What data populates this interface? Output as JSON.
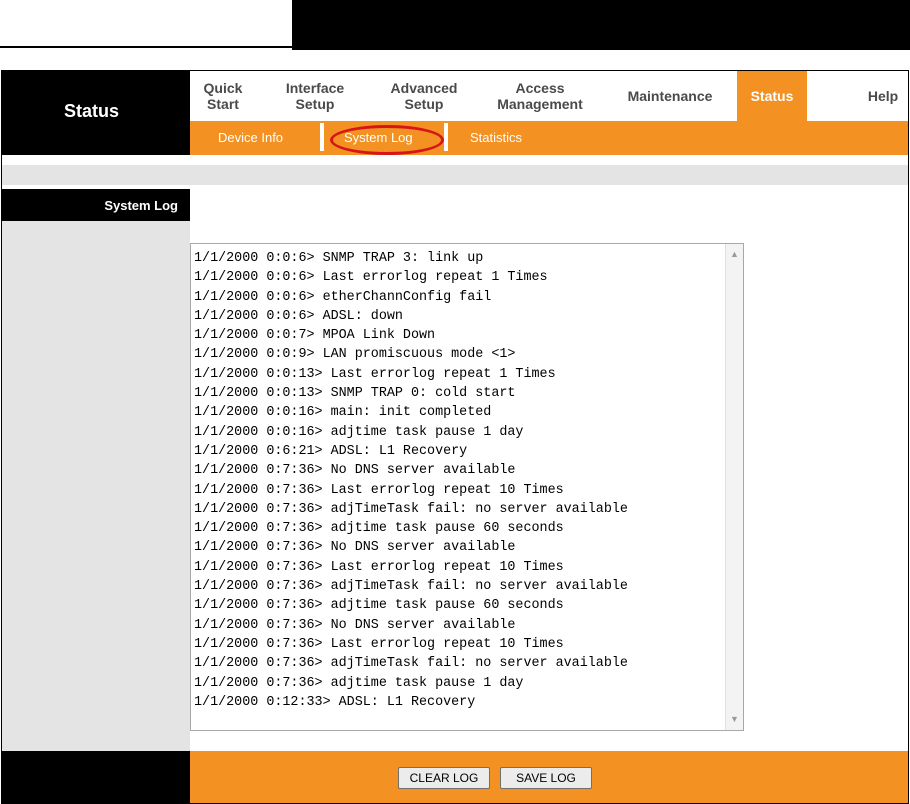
{
  "header": {
    "page_title": "Status"
  },
  "main_nav": [
    {
      "line1": "Quick",
      "line2": "Start"
    },
    {
      "line1": "Interface",
      "line2": "Setup"
    },
    {
      "line1": "Advanced",
      "line2": "Setup"
    },
    {
      "line1": "Access",
      "line2": "Management"
    },
    {
      "line1": "Maintenance",
      "line2": ""
    },
    {
      "line1": "Status",
      "line2": ""
    },
    {
      "line1": "Help",
      "line2": ""
    }
  ],
  "sub_nav": [
    "Device Info",
    "System Log",
    "Statistics"
  ],
  "section": {
    "label": "System Log"
  },
  "log_lines": [
    "1/1/2000 0:0:6> SNMP TRAP 3: link up",
    "1/1/2000 0:0:6> Last errorlog repeat 1 Times",
    "1/1/2000 0:0:6> etherChannConfig fail",
    "1/1/2000 0:0:6> ADSL: down",
    "1/1/2000 0:0:7> MPOA Link Down",
    "1/1/2000 0:0:9> LAN promiscuous mode <1>",
    "1/1/2000 0:0:13> Last errorlog repeat 1 Times",
    "1/1/2000 0:0:13> SNMP TRAP 0: cold start",
    "1/1/2000 0:0:16> main: init completed",
    "1/1/2000 0:0:16> adjtime task pause 1 day",
    "1/1/2000 0:6:21> ADSL: L1 Recovery",
    "1/1/2000 0:7:36> No DNS server available",
    "1/1/2000 0:7:36> Last errorlog repeat 10 Times",
    "1/1/2000 0:7:36> adjTimeTask fail: no server available",
    "1/1/2000 0:7:36> adjtime task pause 60 seconds",
    "1/1/2000 0:7:36> No DNS server available",
    "1/1/2000 0:7:36> Last errorlog repeat 10 Times",
    "1/1/2000 0:7:36> adjTimeTask fail: no server available",
    "1/1/2000 0:7:36> adjtime task pause 60 seconds",
    "1/1/2000 0:7:36> No DNS server available",
    "1/1/2000 0:7:36> Last errorlog repeat 10 Times",
    "1/1/2000 0:7:36> adjTimeTask fail: no server available",
    "1/1/2000 0:7:36> adjtime task pause 1 day",
    "1/1/2000 0:12:33> ADSL: L1 Recovery"
  ],
  "buttons": {
    "clear_log": "CLEAR LOG",
    "save_log": "SAVE LOG"
  },
  "icons": {
    "scroll_up": "scroll-up-arrow-icon",
    "scroll_down": "scroll-down-arrow-icon"
  },
  "colors": {
    "accent_orange": "#f39122",
    "highlight_red": "#d7141a",
    "bar_black": "#000000",
    "panel_gray": "#e4e4e4"
  }
}
